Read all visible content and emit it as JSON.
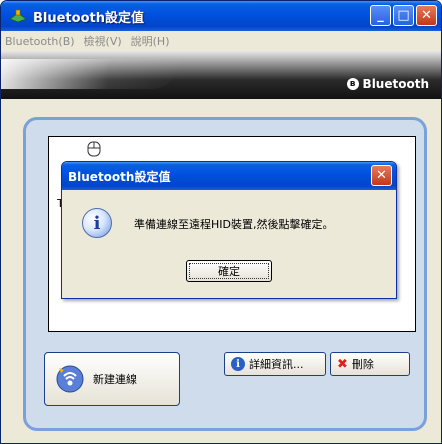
{
  "window": {
    "title": "Bluetooth設定值",
    "controls": {
      "minimize": "_",
      "maximize": "□",
      "close": "✕"
    }
  },
  "menu": {
    "items": [
      "Bluetooth(B)",
      "檢視(V)",
      "說明(H)"
    ]
  },
  "banner": {
    "brand": "Bluetooth",
    "logo_glyph": "ʙ"
  },
  "devices": {
    "partial_label": "T"
  },
  "buttons": {
    "new_connection": "新建連線",
    "details": "詳細資訊...",
    "delete": "刪除"
  },
  "dialog": {
    "title": "Bluetooth設定值",
    "close_glyph": "✕",
    "info_glyph": "i",
    "message": "準備連線至遠程HID裝置,然後點擊確定。",
    "ok": "確定"
  },
  "colors": {
    "title_blue": "#0050e0",
    "panel_bg": "#cfdcec",
    "panel_border": "#7aa1d9",
    "close_red": "#c2381a"
  },
  "icons": {
    "app": "bluetooth-settings-icon",
    "mouse": "mouse-icon",
    "new_connection": "wireless-signal-icon",
    "details": "info-icon",
    "delete": "red-x-icon"
  }
}
